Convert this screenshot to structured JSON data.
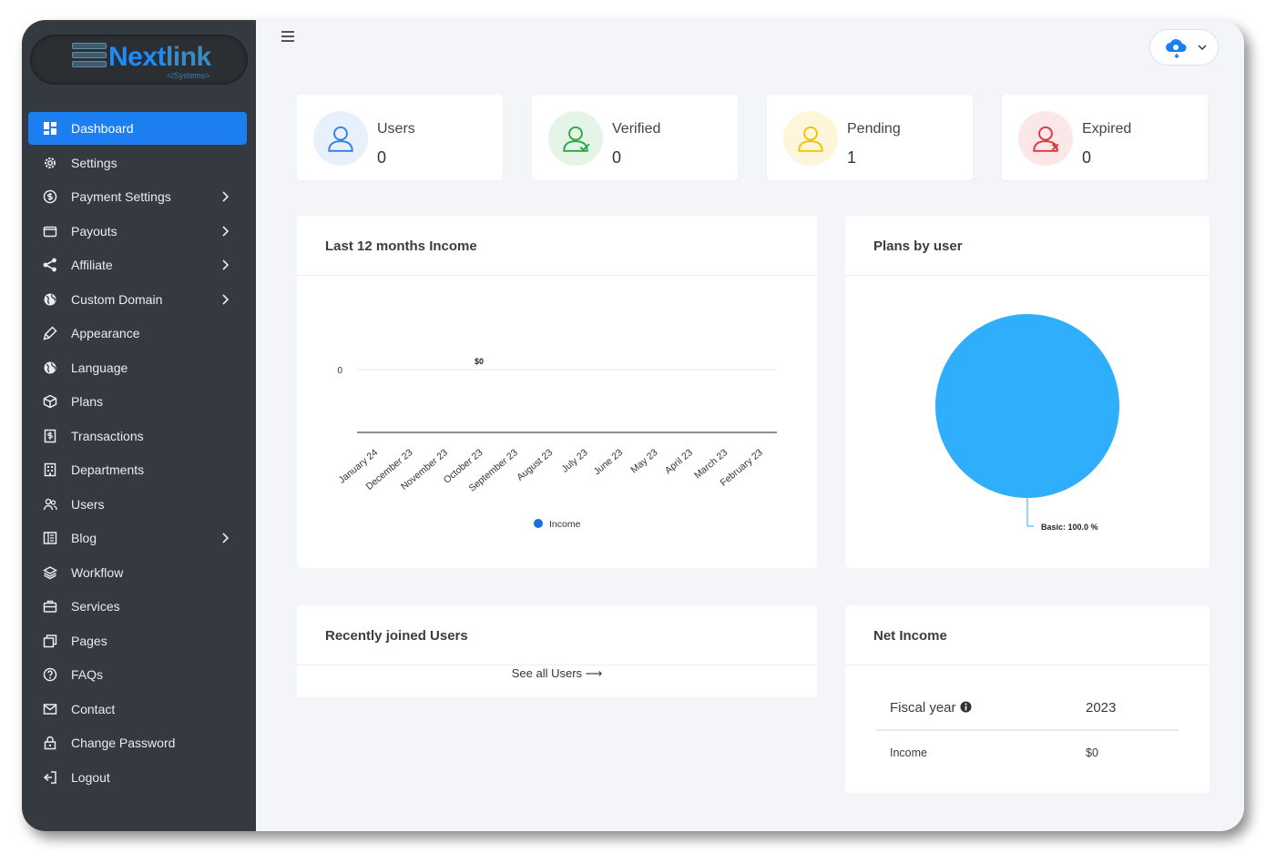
{
  "brand": {
    "name_a": "Next",
    "name_b": "link",
    "sub": "</Systems>"
  },
  "sidebar": {
    "items": [
      {
        "label": "Dashboard",
        "icon": "dashboard-icon",
        "active": true,
        "has_submenu": false
      },
      {
        "label": "Settings",
        "icon": "gear-icon",
        "has_submenu": false
      },
      {
        "label": "Payment Settings",
        "icon": "dollar-circle-icon",
        "has_submenu": true
      },
      {
        "label": "Payouts",
        "icon": "wallet-icon",
        "has_submenu": true
      },
      {
        "label": "Affiliate",
        "icon": "share-icon",
        "has_submenu": true
      },
      {
        "label": "Custom Domain",
        "icon": "globe-icon",
        "has_submenu": true
      },
      {
        "label": "Appearance",
        "icon": "brush-icon",
        "has_submenu": false
      },
      {
        "label": "Language",
        "icon": "globe-icon",
        "has_submenu": false
      },
      {
        "label": "Plans",
        "icon": "box-icon",
        "has_submenu": false
      },
      {
        "label": "Transactions",
        "icon": "receipt-icon",
        "has_submenu": false
      },
      {
        "label": "Departments",
        "icon": "building-icon",
        "has_submenu": false
      },
      {
        "label": "Users",
        "icon": "users-icon",
        "has_submenu": false
      },
      {
        "label": "Blog",
        "icon": "blog-icon",
        "has_submenu": true
      },
      {
        "label": "Workflow",
        "icon": "layers-icon",
        "has_submenu": false
      },
      {
        "label": "Services",
        "icon": "briefcase-icon",
        "has_submenu": false
      },
      {
        "label": "Pages",
        "icon": "pages-icon",
        "has_submenu": false
      },
      {
        "label": "FAQs",
        "icon": "question-icon",
        "has_submenu": false
      },
      {
        "label": "Contact",
        "icon": "mail-icon",
        "has_submenu": false
      },
      {
        "label": "Change Password",
        "icon": "lock-icon",
        "has_submenu": false
      },
      {
        "label": "Logout",
        "icon": "logout-icon",
        "has_submenu": false
      }
    ]
  },
  "stats": [
    {
      "label": "Users",
      "value": "0",
      "color": "#2f80ed",
      "bg": "#e7f0fb",
      "icon": "user-icon"
    },
    {
      "label": "Verified",
      "value": "0",
      "color": "#27a745",
      "bg": "#e4f5e8",
      "icon": "user-check-icon"
    },
    {
      "label": "Pending",
      "value": "1",
      "color": "#f2c200",
      "bg": "#fdf6da",
      "icon": "user-icon"
    },
    {
      "label": "Expired",
      "value": "0",
      "color": "#dc3545",
      "bg": "#fbe6e8",
      "icon": "user-x-icon"
    }
  ],
  "income_card": {
    "title": "Last 12 months Income"
  },
  "plans_card": {
    "title": "Plans by user"
  },
  "recent_card": {
    "title": "Recently joined Users",
    "see_all": "See all Users ⟶"
  },
  "net_card": {
    "title": "Net Income",
    "fiscal_label": "Fiscal year",
    "fiscal_value": "2023",
    "income_label": "Income",
    "income_value": "$0"
  },
  "chart_data": [
    {
      "type": "line",
      "title": "Last 12 months Income",
      "categories": [
        "January 24",
        "December 23",
        "November 23",
        "October 23",
        "September 23",
        "August 23",
        "July 23",
        "June 23",
        "May 23",
        "April 23",
        "March 23",
        "February 23"
      ],
      "series": [
        {
          "name": "Income",
          "values": [
            0,
            0,
            0,
            0,
            0,
            0,
            0,
            0,
            0,
            0,
            0,
            0
          ]
        }
      ],
      "data_label": "$0",
      "y_tick": "0",
      "legend": "bottom",
      "color": "#1b6fe0"
    },
    {
      "type": "pie",
      "title": "Plans by user",
      "slices": [
        {
          "label": "Basic",
          "value": 100.0
        }
      ],
      "slice_label": "Basic: 100.0 %",
      "color": "#2eaefb"
    }
  ]
}
